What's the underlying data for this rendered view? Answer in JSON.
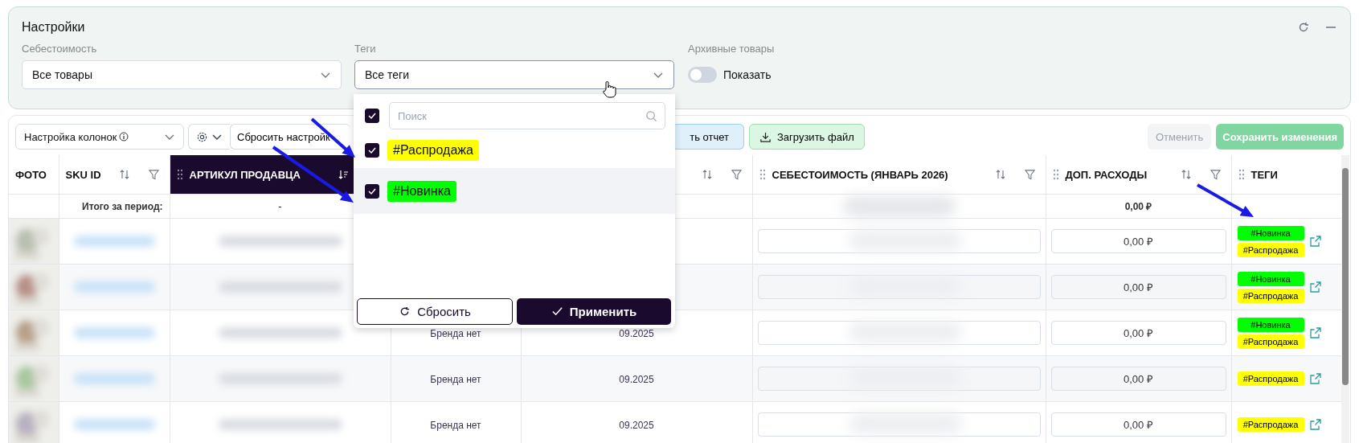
{
  "settings_panel": {
    "title": "Настройки",
    "filters": [
      {
        "label": "Себестоимость",
        "value": "Все товары"
      },
      {
        "label": "Теги",
        "value": "Все теги"
      }
    ],
    "archive": {
      "label": "Архивные товары",
      "toggle_label": "Показать",
      "on": false
    }
  },
  "tag_dropdown": {
    "all_checked": true,
    "search_placeholder": "Поиск",
    "options": [
      {
        "label": "#Распродажа",
        "color": "#ffff00",
        "checked": true,
        "highlighted": false
      },
      {
        "label": "#Новинка",
        "color": "#00ff00",
        "checked": true,
        "highlighted": true
      }
    ],
    "reset_button": "Сбросить",
    "apply_button": "Применить"
  },
  "toolbar": {
    "column_settings": "Настройка колонок",
    "reset_settings": "Сбросить настройк",
    "report_button": "ть отчет",
    "upload_button": "Загрузить файл",
    "cancel_button": "Отменить",
    "save_button": "Сохранить изменения"
  },
  "table": {
    "columns": [
      {
        "label": "ФОТО",
        "kind": "plain"
      },
      {
        "label": "SKU ID",
        "kind": "sortfilter"
      },
      {
        "label": "АРТИКУЛ ПРОДАВЦА",
        "kind": "sorted"
      },
      {
        "kind": "blank"
      },
      {
        "kind": "icons"
      },
      {
        "label": "СЕБЕСТОИМОСТЬ (ЯНВАРЬ 2026)",
        "kind": "dragsortfilter"
      },
      {
        "label": "ДОП. РАСХОДЫ",
        "kind": "dragsortfilter"
      },
      {
        "label": "ТЕГИ",
        "kind": "drag"
      }
    ],
    "totals": {
      "label": "Итого за период:",
      "article": "-",
      "extra": "0,00 ₽"
    },
    "rows": [
      {
        "extra": "0,00 ₽",
        "tags": [
          {
            "label": "#Новинка",
            "color": "#00ff00"
          },
          {
            "label": "#Распродажа",
            "color": "#ffff00"
          }
        ]
      },
      {
        "extra": "0,00 ₽",
        "tags": [
          {
            "label": "#Новинка",
            "color": "#00ff00"
          },
          {
            "label": "#Распродажа",
            "color": "#ffff00"
          }
        ]
      },
      {
        "brand": "Бренда нет",
        "date": "09.2025",
        "extra": "0,00 ₽",
        "tags": [
          {
            "label": "#Новинка",
            "color": "#00ff00"
          },
          {
            "label": "#Распродажа",
            "color": "#ffff00"
          }
        ]
      },
      {
        "brand": "Бренда нет",
        "date": "09.2025",
        "extra": "0,00 ₽",
        "tags": [
          {
            "label": "#Распродажа",
            "color": "#ffff00"
          }
        ]
      },
      {
        "brand": "Бренда нет",
        "date": "09.2025",
        "extra": "0,00 ₽",
        "tags": [
          {
            "label": "#Распродажа",
            "color": "#ffff00"
          }
        ]
      }
    ]
  }
}
